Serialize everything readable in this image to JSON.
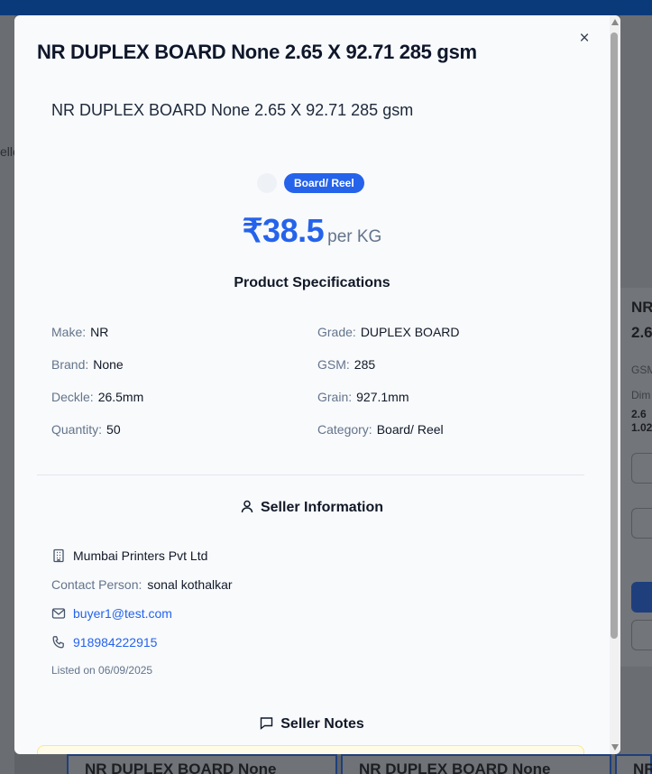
{
  "modal": {
    "title": "NR DUPLEX BOARD None 2.65 X 92.71 285 gsm",
    "close_label": "×",
    "subtitle": "NR DUPLEX BOARD None 2.65 X 92.71 285 gsm",
    "category_badge": "Board/ Reel",
    "price": "₹38.5",
    "price_unit": "per KG",
    "specs_heading": "Product Specifications",
    "specs": {
      "make": {
        "label": "Make:",
        "value": "NR"
      },
      "grade": {
        "label": "Grade:",
        "value": "DUPLEX BOARD"
      },
      "brand": {
        "label": "Brand:",
        "value": "None"
      },
      "gsm": {
        "label": "GSM:",
        "value": "285"
      },
      "deckle": {
        "label": "Deckle:",
        "value": "26.5mm"
      },
      "grain": {
        "label": "Grain:",
        "value": "927.1mm"
      },
      "quantity": {
        "label": "Quantity:",
        "value": "50"
      },
      "category": {
        "label": "Category:",
        "value": "Board/ Reel"
      }
    },
    "seller": {
      "heading": "Seller Information",
      "company": "Mumbai Printers Pvt Ltd",
      "contact_label": "Contact Person:",
      "contact_value": "sonal kothalkar",
      "email": "buyer1@test.com",
      "phone": "918984222915",
      "listed_on": "Listed on 06/09/2025"
    },
    "notes_heading": "Seller Notes"
  },
  "background": {
    "bottom_cards": [
      "NR DUPLEX BOARD None",
      "NR DUPLEX BOARD None",
      "NR"
    ],
    "right_card": {
      "title_line1": "NR",
      "title_line2": "2.6",
      "gsm": "GSM",
      "dim": "Dim",
      "dim_v1": "2.6",
      "dim_v2": "1.02"
    },
    "left_text": "elle"
  },
  "colors": {
    "accent": "#2563eb",
    "topbar": "#0a3a7a",
    "modal_bg": "#f8fafc",
    "notes_bg": "#fefce8"
  }
}
